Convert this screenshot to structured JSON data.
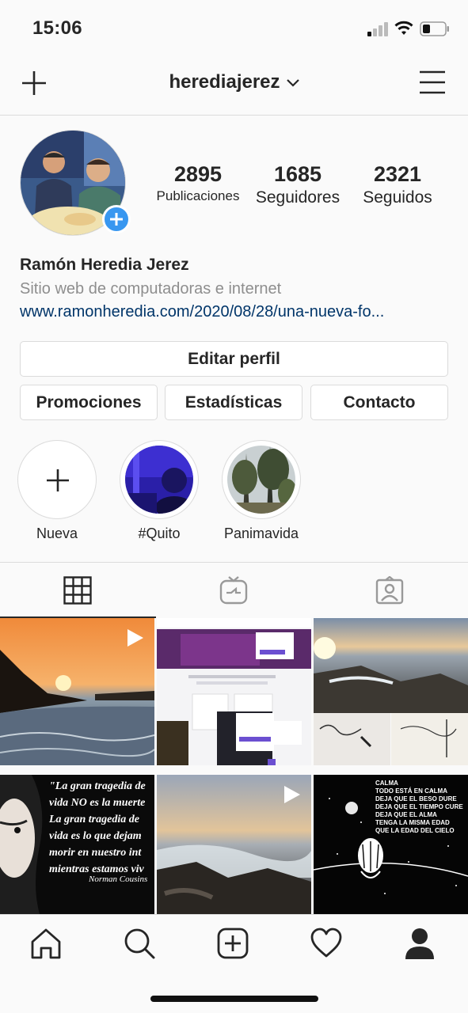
{
  "status_bar": {
    "time": "15:06",
    "icons": [
      "signal-icon",
      "wifi-icon",
      "battery-icon"
    ]
  },
  "header": {
    "username": "herediajerez",
    "left_icon": "plus-icon",
    "right_icon": "menu-icon"
  },
  "profile": {
    "stats": [
      {
        "value": "2895",
        "label": "Publicaciones"
      },
      {
        "value": "1685",
        "label": "Seguidores"
      },
      {
        "value": "2321",
        "label": "Seguidos"
      }
    ],
    "full_name": "Ramón Heredia Jerez",
    "category": "Sitio web de computadoras e internet",
    "website": "www.ramonheredia.com/2020/08/28/una-nueva-fo..."
  },
  "buttons": {
    "edit": "Editar perfil",
    "promotions": "Promociones",
    "statistics": "Estadísticas",
    "contact": "Contacto"
  },
  "highlights": [
    {
      "label": "Nueva"
    },
    {
      "label": "#Quito"
    },
    {
      "label": "Panimavida"
    }
  ],
  "tabs": [
    "grid-icon",
    "igtv-icon",
    "tagged-icon"
  ],
  "grid_posts": {
    "quote": {
      "lines": [
        "\"La gran tragedia de",
        "vida NO es la muerte",
        "La gran tragedia de",
        "vida es lo que dejam",
        "morir en nuestro int",
        "mientras estamos viv"
      ],
      "author": "Norman Cousins"
    },
    "poem": {
      "text": "CALMA\nTODO ESTÁ EN CALMA\nDEJA QUE EL BESO DURE\nDEJA QUE EL TIEMPO CURE\nDEJA QUE EL ALMA\nTENGA LA MISMA EDAD\nQUE LA EDAD DEL CIELO"
    }
  },
  "bottom_nav": [
    "home-icon",
    "search-icon",
    "new-post-icon",
    "activity-heart-icon",
    "profile-icon"
  ],
  "colors": {
    "accent": "#3897f0",
    "link": "#003569",
    "muted": "#8e8e8e",
    "text": "#262626"
  }
}
